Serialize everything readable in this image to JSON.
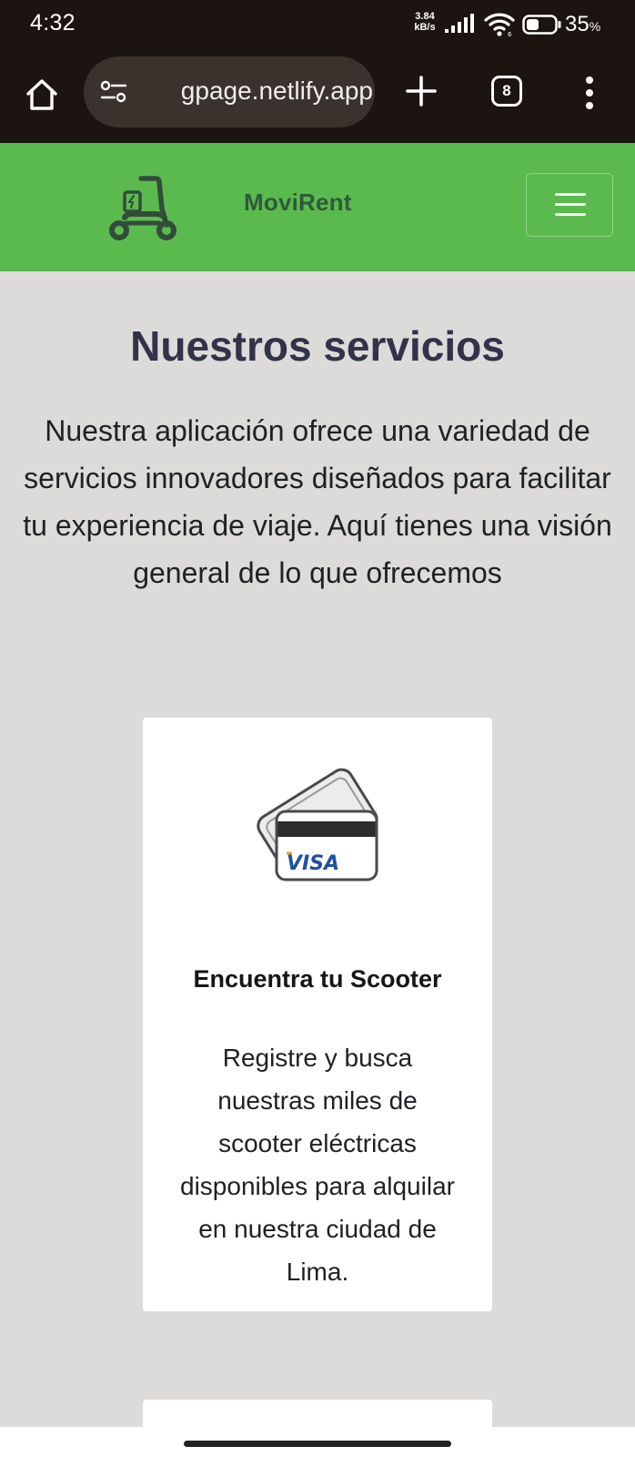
{
  "status_bar": {
    "time": "4:32",
    "net_speed_value": "3.84",
    "net_speed_unit": "kB/s",
    "battery_value": "35",
    "battery_unit": "%"
  },
  "browser": {
    "url": "gpage.netlify.app",
    "tab_count": "8"
  },
  "navbar": {
    "brand": "MoviRent",
    "accent_color": "#5bba4e"
  },
  "services": {
    "title": "Nuestros servicios",
    "intro": "Nuestra aplicación ofrece una variedad de servicios innovadores diseñados para facilitar tu experiencia de viaje. Aquí tienes una visión general de lo que ofrecemos",
    "cards": [
      {
        "icon": "credit-card-visa-icon",
        "card_brand": "VISA",
        "title": "Encuentra tu Scooter",
        "text": "Registre y busca nuestras miles de scooter eléctricas disponibles para alquilar en nuestra ciudad de Lima."
      }
    ]
  }
}
